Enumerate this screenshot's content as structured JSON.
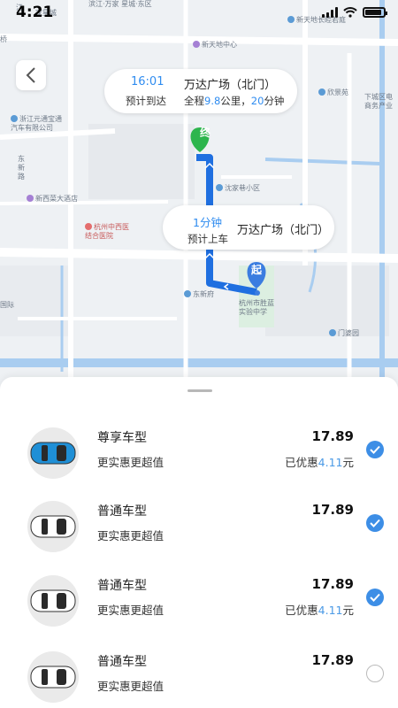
{
  "status": {
    "time": "4:21"
  },
  "map": {
    "labels": [
      "滨江·万家\n星城·东区",
      "新天地中心",
      "新天地长睦若庭",
      "浙江元通宝通\n汽车有限公司",
      "东\n新\n路",
      "新西菜大酒店",
      "杭州中西医\n结合医院",
      "沈家巷小区",
      "东新府",
      "杭州市胜蓝\n实验中学",
      "欣景苑",
      "下城区电\n商务产业",
      "门婆园",
      "家星城",
      "桥",
      "江",
      "国际"
    ],
    "start_marker": "起",
    "end_marker": "终"
  },
  "trip": {
    "arrive_time": "16:01",
    "arrive_label": "预计到达",
    "destination": "万达广场（北门）",
    "distance_prefix": "全程",
    "distance": "9.8",
    "distance_mid": "公里，",
    "duration": "20",
    "duration_suffix": "分钟"
  },
  "pickup": {
    "minutes": "1分钟",
    "label": "预计上车",
    "destination": "万达广场（北门）"
  },
  "cars": [
    {
      "name": "尊享车型",
      "subtitle": "更实惠更超值",
      "price": "17.89",
      "discount_prefix": "已优惠",
      "discount": "4.11",
      "discount_suffix": "元",
      "selected": true,
      "color": "#1f8fd6"
    },
    {
      "name": "普通车型",
      "subtitle": "更实惠更超值",
      "price": "17.89",
      "discount_prefix": "",
      "discount": "",
      "discount_suffix": "",
      "selected": true,
      "color": "#ffffff"
    },
    {
      "name": "普通车型",
      "subtitle": "更实惠更超值",
      "price": "17.89",
      "discount_prefix": "已优惠",
      "discount": "4.11",
      "discount_suffix": "元",
      "selected": true,
      "color": "#ffffff"
    },
    {
      "name": "普通车型",
      "subtitle": "更实惠更超值",
      "price": "17.89",
      "discount_prefix": "",
      "discount": "",
      "discount_suffix": "",
      "selected": false,
      "color": "#ffffff"
    }
  ],
  "colors": {
    "accent": "#2f8cf0",
    "route": "#1f6fe0",
    "start_marker": "#3b7de0",
    "end_marker": "#2db54d"
  }
}
